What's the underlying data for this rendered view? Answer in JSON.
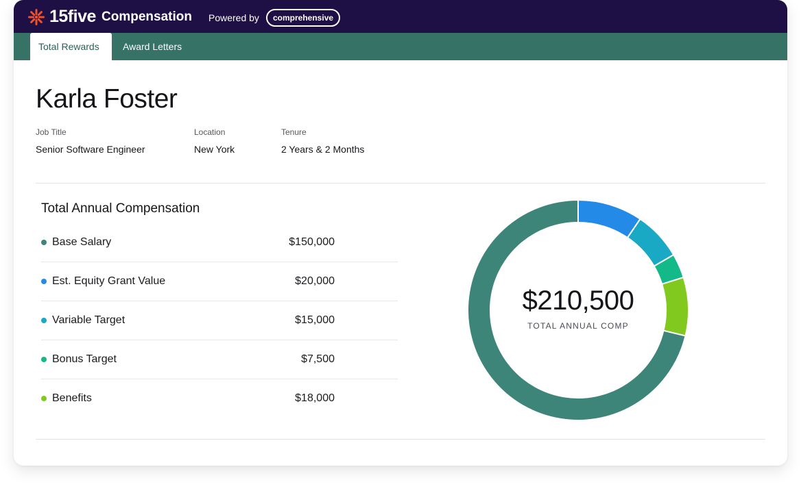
{
  "header": {
    "brand": "15five",
    "product": "Compensation",
    "powered_by": "Powered by",
    "partner": "comprehensive",
    "logo_icon": "starburst-logo-icon",
    "colors": {
      "bar": "#1e0f44",
      "logo": "#f0502a"
    }
  },
  "tabs": [
    {
      "label": "Total Rewards",
      "active": true
    },
    {
      "label": "Award Letters",
      "active": false
    }
  ],
  "employee": {
    "name": "Karla Foster",
    "fields": [
      {
        "label": "Job Title",
        "value": "Senior Software Engineer"
      },
      {
        "label": "Location",
        "value": "New York"
      },
      {
        "label": "Tenure",
        "value": "2 Years & 2 Months"
      }
    ]
  },
  "compensation": {
    "title": "Total Annual Compensation",
    "items": [
      {
        "label": "Base Salary",
        "value": "$150,000",
        "color": "#3d8579"
      },
      {
        "label": "Est. Equity Grant Value",
        "value": "$20,000",
        "color": "#238ae8"
      },
      {
        "label": "Variable Target",
        "value": "$15,000",
        "color": "#19a9c4"
      },
      {
        "label": "Bonus Target",
        "value": "$7,500",
        "color": "#14b98a"
      },
      {
        "label": "Benefits",
        "value": "$18,000",
        "color": "#82c91f"
      }
    ],
    "total": "$210,500",
    "total_caption": "TOTAL ANNUAL COMP"
  },
  "chart_data": {
    "type": "pie",
    "categories": [
      "Base Salary",
      "Est. Equity Grant Value",
      "Variable Target",
      "Bonus Target",
      "Benefits"
    ],
    "values": [
      150000,
      20000,
      15000,
      7500,
      18000
    ],
    "colors": [
      "#3d8579",
      "#238ae8",
      "#19a9c4",
      "#14b98a",
      "#82c91f"
    ],
    "order_clockwise_from_top": [
      "Est. Equity Grant Value",
      "Variable Target",
      "Bonus Target",
      "Benefits",
      "Base Salary"
    ]
  }
}
